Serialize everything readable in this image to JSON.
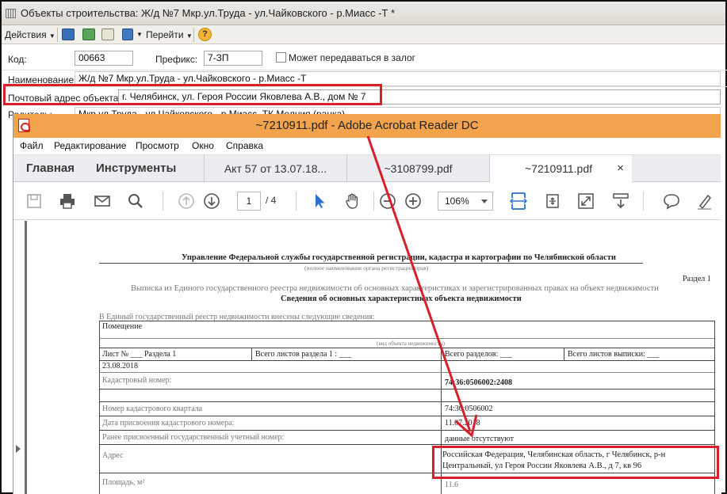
{
  "c1": {
    "window_title": "Объекты строительства: Ж/д №7 Мкр.ул.Труда - ул.Чайковского - р.Миасс -Т *",
    "toolbar": {
      "actions": "Действия",
      "goto": "Перейти",
      "help": "?"
    },
    "fields": {
      "code_label": "Код:",
      "code_value": "00663",
      "prefix_label": "Префикс:",
      "prefix_value": "7-ЗП",
      "pledge_label": "Может передаваться в залог",
      "name_label": "Наименование:",
      "name_value": "Ж/д №7 Мкр.ул.Труда - ул.Чайковского - р.Миасс -Т",
      "address_label": "Почтовый адрес объекта:",
      "address_value": "г. Челябинск, ул. Героя России Яковлева А.В., дом № 7",
      "parents_label": "Родитель:",
      "parents_value": "Мкр.ул.Труда - ул.Чайковского - р.Миасс, ТК Мелния (ранка)"
    }
  },
  "acro": {
    "title": "~7210911.pdf - Adobe Acrobat Reader DC",
    "menu": [
      "Файл",
      "Редактирование",
      "Просмотр",
      "Окно",
      "Справка"
    ],
    "tabs": {
      "home": "Главная",
      "tools": "Инструменты"
    },
    "docs": [
      "Акт 57 от 13.07.18...",
      "~3108799.pdf",
      "~7210911.pdf"
    ],
    "close": "×",
    "page_current": "1",
    "page_total": "/ 4",
    "zoom": "106%",
    "colors": {
      "titlebar": "#f2a34c",
      "accent": "#2d6fd3",
      "annotation": "#d8202a"
    }
  },
  "doc": {
    "header": "Управление Федеральной службы государственной регистрации, кадастра и картографии по Челябинской области",
    "header_sub": "(полное наименование органа регистрации прав)",
    "section": "Раздел 1",
    "extract": "Выписка из Единого государственного реестра недвижимости об основных характеристиках и зарегистрированных правах на объект недвижимости",
    "info_title": "Сведения об основных характеристиках объекта недвижимости",
    "intro": "В Единый государственный реестр недвижимости внесены следующие сведения:",
    "object_type": "Помещение",
    "object_type_hint": "(вид объекта недвижимости)",
    "sheet": "Лист № ___ Раздела  1",
    "sheets_total": "Всего листов раздела  1 : ___",
    "sections_total": "Всего разделов: ___",
    "extract_sheets": "Всего листов выписки: ___",
    "date": "23.08.2018",
    "cad_num_label": "Кадастровый номер:",
    "cad_num_value": "74:36:0506002:2408",
    "block_label": "Номер кадастрового квартала",
    "block_value": "74:36:0506002",
    "date_assigned_label": "Дата присвоения кадастрового номера:",
    "date_assigned_value": "11.07.2018",
    "prev_num_label": "Ранее присвоенный государственный учетный номер:",
    "prev_num_value": "данные отсутствуют",
    "address_label": "Адрес",
    "address_line1": "Российская Федерация, Челябинская область, г Челябинск, р-н",
    "address_line2": "Центральный, ул Героя России Яковлева А.В., д 7, кв 96",
    "area_label": "Площадь, м²",
    "area_value": "11.6"
  }
}
